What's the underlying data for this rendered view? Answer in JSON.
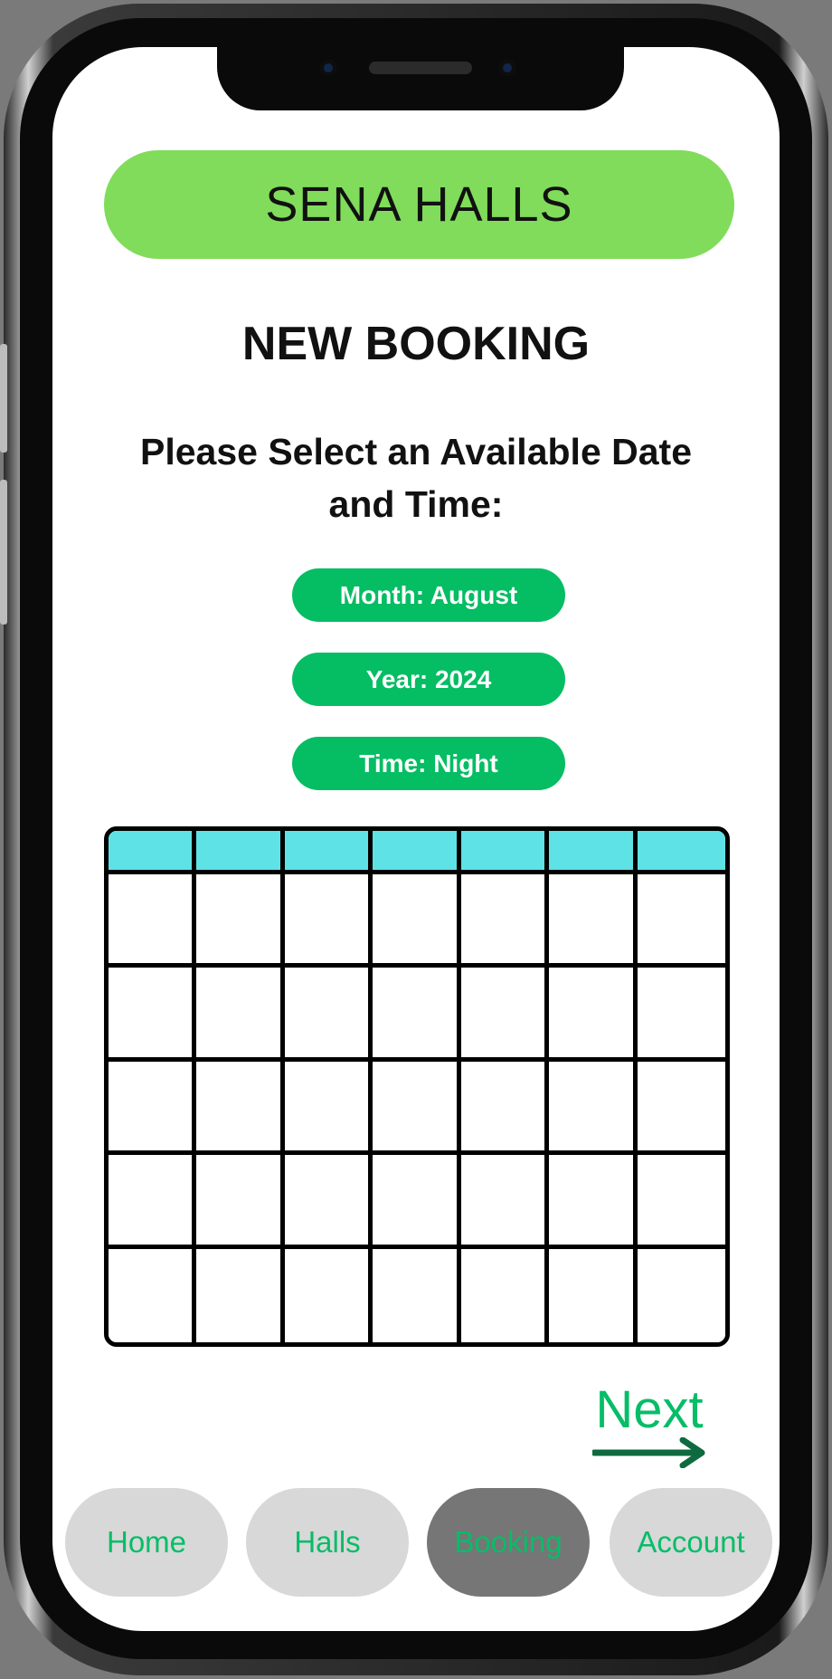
{
  "app": {
    "brand": "SENA HALLS"
  },
  "page": {
    "title": "NEW BOOKING",
    "instruction": "Please Select an Available Date and Time:"
  },
  "selectors": {
    "month": "Month: August",
    "year": "Year: 2024",
    "time": "Time: Night"
  },
  "calendar": {
    "columns": 7,
    "rows": 5
  },
  "actions": {
    "next_label": "Next"
  },
  "nav": {
    "items": [
      {
        "label": "Home"
      },
      {
        "label": "Halls"
      },
      {
        "label": "Booking",
        "active": true
      },
      {
        "label": "Account"
      }
    ]
  },
  "colors": {
    "brand_pill": "#80dc5a",
    "selector": "#05bd63",
    "calendar_header": "#5ee2e6",
    "accent_text": "#06bd68",
    "nav_inactive": "#d8d8d8",
    "nav_active": "#767676"
  }
}
